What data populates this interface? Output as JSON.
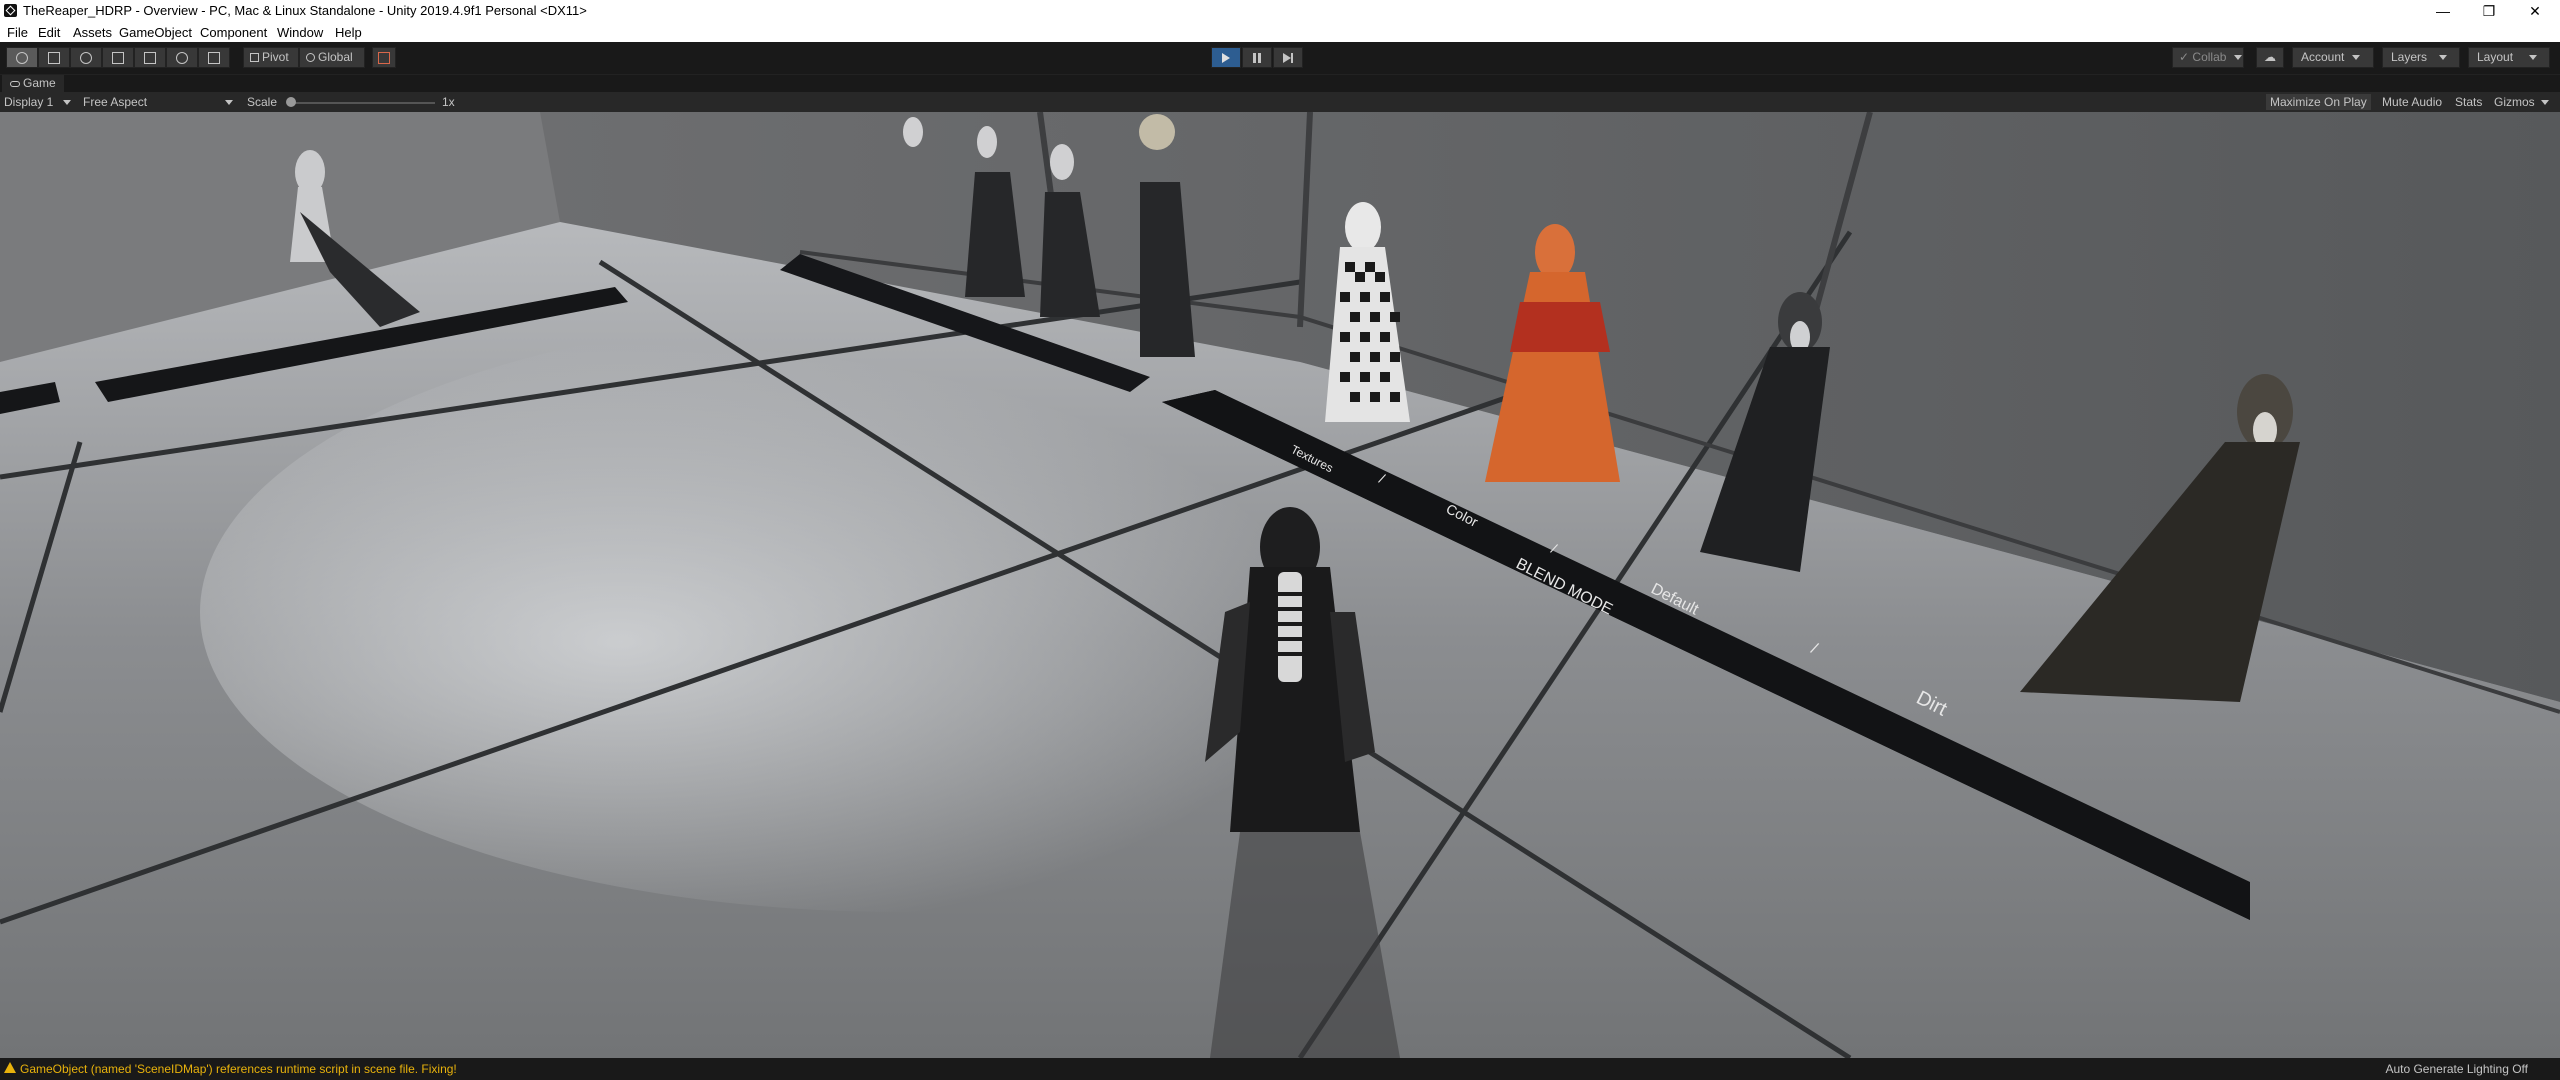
{
  "window": {
    "title": "TheReaper_HDRP - Overview - PC, Mac & Linux Standalone - Unity 2019.4.9f1 Personal <DX11>",
    "minimize": "—",
    "restore": "❐",
    "close": "✕"
  },
  "menu": [
    "File",
    "Edit",
    "Assets",
    "GameObject",
    "Component",
    "Window",
    "Help"
  ],
  "toolbar": {
    "pivot": "Pivot",
    "global": "Global",
    "collab": "Collab",
    "account": "Account",
    "layers": "Layers",
    "layout": "Layout"
  },
  "tab": {
    "game": "Game"
  },
  "game_bar": {
    "display": "Display 1",
    "aspect": "Free Aspect",
    "scale_label": "Scale",
    "scale_value": "1x",
    "maximize": "Maximize On Play",
    "mute": "Mute Audio",
    "stats": "Stats",
    "gizmos": "Gizmos"
  },
  "scene_labels": {
    "textures": "Textures",
    "slash1": "/",
    "color": "Color",
    "slash2": "/",
    "blend_mode": "BLEND MODE",
    "default": "Default",
    "slash3": "/",
    "dirt": "Dirt"
  },
  "status": {
    "message": "GameObject (named 'SceneIDMap') references runtime script in scene file. Fixing!",
    "lighting": "Auto Generate Lighting Off"
  },
  "colors": {
    "warning": "#e8b20c",
    "play_active": "#2d5d91",
    "editor_bg": "#191919"
  }
}
